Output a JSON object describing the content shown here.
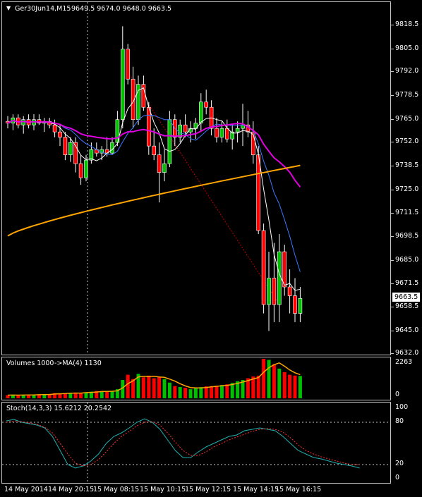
{
  "main_header": {
    "symbol": "Ger30Jun14,M15",
    "ohlc": "9649.5 9674.0 9648.0 9663.5",
    "icon": "triangle-down-icon"
  },
  "volume_header": {
    "label": "Volumes 1000",
    "ma_label": "->MA(4) 1130"
  },
  "stoch_header": {
    "label": "Stoch(14,3,3) 15.6212 20.2542"
  },
  "current_price": "9663.5",
  "price_axis": [
    "9818.5",
    "9805.0",
    "9792.0",
    "9778.5",
    "9765.0",
    "9752.0",
    "9738.5",
    "9725.0",
    "9711.5",
    "9698.5",
    "9685.0",
    "9671.5",
    "9658.5",
    "9645.0",
    "9632.0"
  ],
  "volume_axis": [
    "2263",
    "0"
  ],
  "stoch_axis": [
    "100",
    "80",
    "20",
    "0"
  ],
  "time_axis": [
    "14 May 2014",
    "14 May 20:15",
    "15 May 08:15",
    "15 May 10:15",
    "15 May 12:15",
    "15 May 14:15",
    "15 May 16:15"
  ],
  "colors": {
    "bull": "#00c000",
    "bear": "#ff0000",
    "ma_fast": "#ffffff",
    "ma_blue": "#3c78ff",
    "ma_magenta": "#e000e0",
    "ma_orange": "#ffa500",
    "grid": "#c8c8c8"
  },
  "chart_data": [
    {
      "type": "candlestick",
      "ylim": [
        9632.0,
        9818.5
      ],
      "candles": [
        [
          9764,
          9767,
          9760,
          9763
        ],
        [
          9763,
          9768,
          9759,
          9766
        ],
        [
          9766,
          9768,
          9760,
          9762
        ],
        [
          9762,
          9767,
          9757,
          9765
        ],
        [
          9765,
          9768,
          9760,
          9762
        ],
        [
          9762,
          9768,
          9759,
          9765
        ],
        [
          9765,
          9768,
          9762,
          9763
        ],
        [
          9763,
          9766,
          9758,
          9764
        ],
        [
          9764,
          9766,
          9760,
          9762
        ],
        [
          9762,
          9765,
          9755,
          9758
        ],
        [
          9758,
          9762,
          9750,
          9755
        ],
        [
          9755,
          9758,
          9742,
          9745
        ],
        [
          9745,
          9755,
          9741,
          9752
        ],
        [
          9752,
          9755,
          9735,
          9740
        ],
        [
          9740,
          9745,
          9728,
          9732
        ],
        [
          9732,
          9745,
          9730,
          9742
        ],
        [
          9742,
          9752,
          9740,
          9748
        ],
        [
          9748,
          9752,
          9744,
          9746
        ],
        [
          9746,
          9750,
          9742,
          9748
        ],
        [
          9748,
          9755,
          9744,
          9746
        ],
        [
          9746,
          9755,
          9745,
          9752
        ],
        [
          9752,
          9770,
          9750,
          9765
        ],
        [
          9765,
          9818,
          9760,
          9805
        ],
        [
          9805,
          9808,
          9785,
          9788
        ],
        [
          9788,
          9795,
          9760,
          9765
        ],
        [
          9765,
          9790,
          9762,
          9785
        ],
        [
          9785,
          9790,
          9770,
          9772
        ],
        [
          9772,
          9775,
          9745,
          9750
        ],
        [
          9750,
          9760,
          9742,
          9745
        ],
        [
          9745,
          9752,
          9718,
          9735
        ],
        [
          9735,
          9748,
          9730,
          9740
        ],
        [
          9740,
          9770,
          9738,
          9765
        ],
        [
          9765,
          9768,
          9750,
          9755
        ],
        [
          9755,
          9765,
          9752,
          9762
        ],
        [
          9762,
          9768,
          9755,
          9758
        ],
        [
          9758,
          9764,
          9752,
          9760
        ],
        [
          9760,
          9766,
          9754,
          9763
        ],
        [
          9763,
          9780,
          9758,
          9775
        ],
        [
          9775,
          9782,
          9768,
          9772
        ],
        [
          9772,
          9776,
          9756,
          9760
        ],
        [
          9760,
          9766,
          9752,
          9755
        ],
        [
          9755,
          9764,
          9752,
          9760
        ],
        [
          9760,
          9765,
          9752,
          9754
        ],
        [
          9754,
          9762,
          9748,
          9758
        ],
        [
          9758,
          9764,
          9752,
          9760
        ],
        [
          9760,
          9774,
          9750,
          9762
        ],
        [
          9762,
          9770,
          9755,
          9758
        ],
        [
          9758,
          9764,
          9740,
          9745
        ],
        [
          9745,
          9750,
          9700,
          9702
        ],
        [
          9702,
          9706,
          9655,
          9660
        ],
        [
          9660,
          9690,
          9645,
          9675
        ],
        [
          9675,
          9695,
          9650,
          9660
        ],
        [
          9660,
          9700,
          9650,
          9690
        ],
        [
          9690,
          9694,
          9665,
          9670
        ],
        [
          9670,
          9680,
          9655,
          9665
        ],
        [
          9665,
          9675,
          9650,
          9655
        ],
        [
          9655,
          9670,
          9650,
          9663.5
        ]
      ]
    },
    {
      "type": "bar",
      "series": [
        {
          "name": "Volumes",
          "values": [
            180,
            190,
            170,
            200,
            210,
            190,
            230,
            210,
            250,
            300,
            280,
            260,
            320,
            330,
            290,
            350,
            380,
            420,
            400,
            380,
            420,
            520,
            1050,
            1350,
            1100,
            1400,
            1200,
            1300,
            1150,
            1250,
            1100,
            900,
            700,
            650,
            600,
            520,
            620,
            640,
            680,
            700,
            720,
            760,
            800,
            880,
            980,
            1050,
            1150,
            1250,
            1300,
            2263,
            2200,
            1950,
            1700,
            1500,
            1350,
            1300,
            1280
          ]
        }
      ],
      "ma_label": "MA(4)",
      "ylim": [
        0,
        2263
      ]
    },
    {
      "type": "line",
      "series": [
        {
          "name": "Stoch %K",
          "values": [
            82,
            84,
            80,
            78,
            76,
            72,
            60,
            40,
            20,
            15,
            18,
            25,
            35,
            50,
            60,
            65,
            72,
            80,
            85,
            80,
            70,
            55,
            40,
            30,
            30,
            38,
            45,
            50,
            55,
            60,
            62,
            68,
            70,
            72,
            70,
            68,
            60,
            50,
            40,
            35,
            30,
            28,
            25,
            22,
            20,
            18,
            15
          ]
        },
        {
          "name": "Stoch %D",
          "values": [
            80,
            82,
            81,
            79,
            77,
            73,
            65,
            50,
            35,
            22,
            18,
            20,
            27,
            38,
            50,
            60,
            67,
            75,
            80,
            81,
            76,
            65,
            52,
            40,
            33,
            33,
            38,
            45,
            50,
            55,
            59,
            63,
            67,
            70,
            71,
            70,
            66,
            58,
            48,
            40,
            35,
            31,
            28,
            25,
            22,
            20,
            20
          ]
        }
      ],
      "ylim": [
        0,
        100
      ]
    }
  ]
}
